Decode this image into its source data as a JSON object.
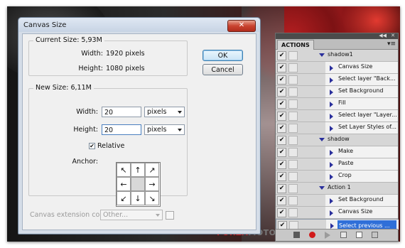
{
  "background": {
    "brand_text_1": "FORZA",
    "brand_text_2": "MOTO",
    "accent_color": "#b21e20"
  },
  "dialog": {
    "title": "Canvas Size",
    "close_icon": "close-icon",
    "current_size": {
      "legend": "Current Size: 5,93M",
      "width_label": "Width:",
      "width_value": "1920 pixels",
      "height_label": "Height:",
      "height_value": "1080 pixels"
    },
    "new_size": {
      "legend": "New Size: 6,11M",
      "width_label": "Width:",
      "width_value": "20",
      "width_unit": "pixels",
      "height_label": "Height:",
      "height_value": "20",
      "height_unit": "pixels",
      "relative_label": "Relative",
      "relative_checked": true,
      "anchor_label": "Anchor:"
    },
    "ok_label": "OK",
    "cancel_label": "Cancel",
    "extension_color_label": "Canvas extension color:",
    "extension_color_value": "Other..."
  },
  "actions_panel": {
    "tab_label": "ACTIONS",
    "rows": [
      {
        "type": "set",
        "label": "shadow1",
        "checked": true
      },
      {
        "type": "step",
        "label": "Canvas Size",
        "checked": true
      },
      {
        "type": "step",
        "label": "Select layer \"Back...",
        "checked": true
      },
      {
        "type": "step",
        "label": "Set Background",
        "checked": true
      },
      {
        "type": "step",
        "label": "Fill",
        "checked": true
      },
      {
        "type": "step",
        "label": "Select layer \"Layer...",
        "checked": true
      },
      {
        "type": "step",
        "label": "Set Layer Styles of...",
        "checked": true
      },
      {
        "type": "set",
        "label": "shadow",
        "checked": true
      },
      {
        "type": "step",
        "label": "Make",
        "checked": true
      },
      {
        "type": "step",
        "label": "Paste",
        "checked": true
      },
      {
        "type": "step",
        "label": "Crop",
        "checked": true
      },
      {
        "type": "set",
        "label": "Action 1",
        "checked": true
      },
      {
        "type": "step",
        "label": "Set Background",
        "checked": true
      },
      {
        "type": "step",
        "label": "Canvas Size",
        "checked": true
      },
      {
        "type": "step",
        "label": "Select previous ...",
        "checked": true,
        "selected": true
      }
    ]
  }
}
